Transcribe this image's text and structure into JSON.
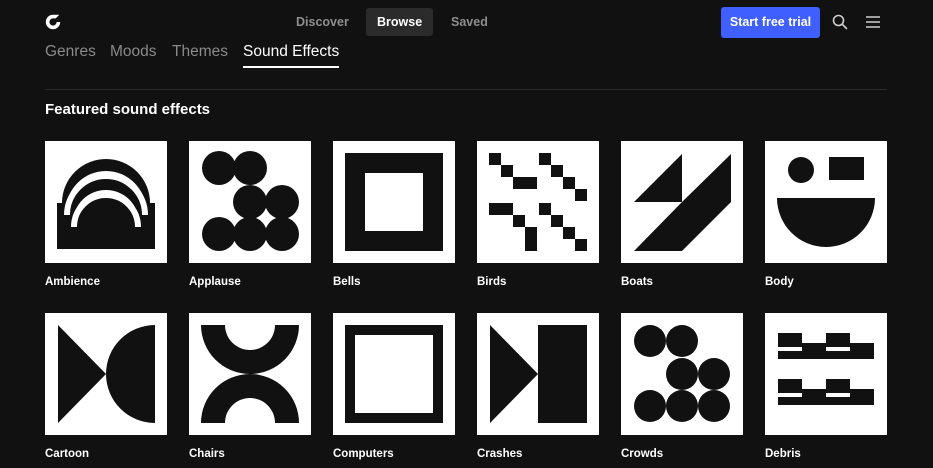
{
  "header": {
    "nav": [
      "Discover",
      "Browse",
      "Saved"
    ],
    "active_nav": "Browse",
    "cta_label": "Start free trial",
    "search_icon": "search-icon",
    "menu_icon": "hamburger-menu-icon",
    "logo_icon": "brand-logo-icon"
  },
  "subnav": {
    "tabs": [
      "Genres",
      "Moods",
      "Themes",
      "Sound Effects"
    ],
    "active": "Sound Effects"
  },
  "section": {
    "title": "Featured sound effects"
  },
  "cards": [
    {
      "label": "Ambience"
    },
    {
      "label": "Applause"
    },
    {
      "label": "Bells"
    },
    {
      "label": "Birds"
    },
    {
      "label": "Boats"
    },
    {
      "label": "Body"
    },
    {
      "label": "Cartoon"
    },
    {
      "label": "Chairs"
    },
    {
      "label": "Computers"
    },
    {
      "label": "Crashes"
    },
    {
      "label": "Crowds"
    },
    {
      "label": "Debris"
    }
  ],
  "colors": {
    "background": "#111111",
    "accent": "#3f5fff",
    "muted_text": "#8e8e8e",
    "tile": "#ffffff",
    "art": "#111111"
  }
}
